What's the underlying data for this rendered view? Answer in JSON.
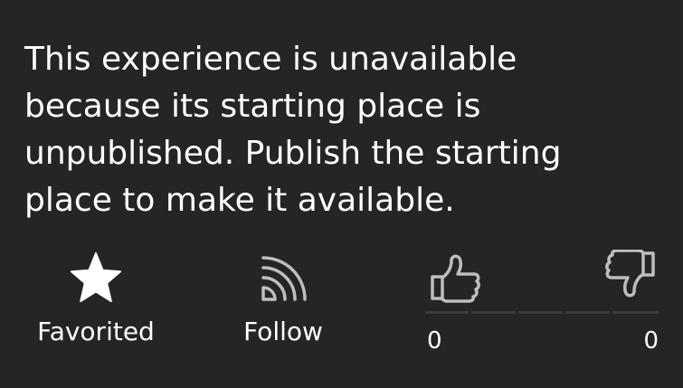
{
  "message": "This experience is unavailable because its starting place is unpublished. Publish the starting place to make it available.",
  "actions": {
    "favorite": {
      "label": "Favorited",
      "icon": "star-icon"
    },
    "follow": {
      "label": "Follow",
      "icon": "follow-feed-icon"
    }
  },
  "votes": {
    "up_icon": "thumbs-up-icon",
    "down_icon": "thumbs-down-icon",
    "up_count": "0",
    "down_count": "0"
  },
  "colors": {
    "background": "#232527",
    "text": "#ffffff",
    "icon_outline": "#bdbebe",
    "vote_bar": "#393b3d"
  }
}
